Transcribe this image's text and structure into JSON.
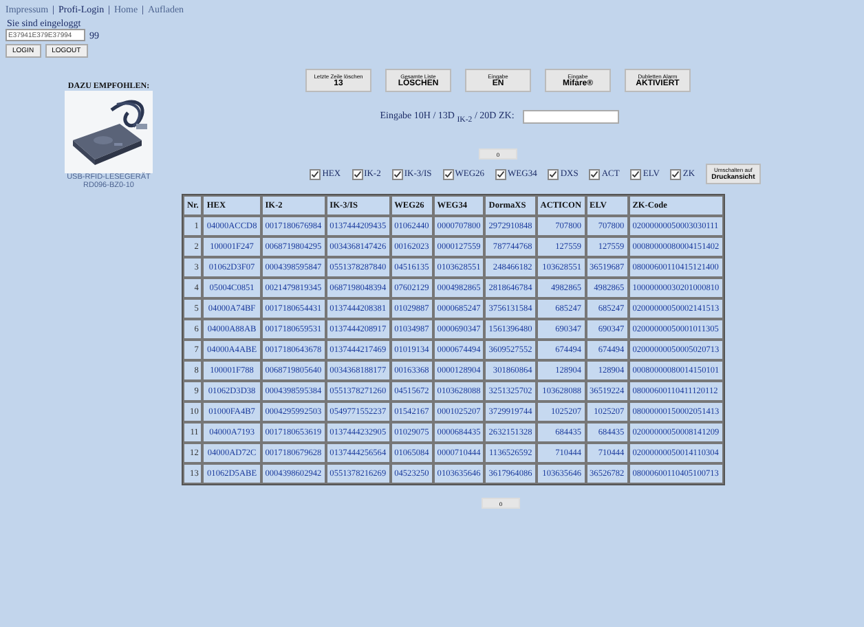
{
  "nav_links": [
    "Impressum",
    "Profi-Login",
    "Home",
    "Aufladen"
  ],
  "nav_separator": "|",
  "login": {
    "status": "Sie sind eingeloggt",
    "field_value": "E37941E379E37994",
    "count": "99",
    "buttons": [
      "LOGIN",
      "LOGOUT"
    ]
  },
  "recommendation": {
    "heading": "DAZU EMPFOHLEN:",
    "product_name": "USB-RFID-LESEGERÄT",
    "product_code": "RD096-BZ0-10"
  },
  "action_buttons": [
    {
      "label": "Letzte Zeile löschen",
      "value": "13"
    },
    {
      "label": "Gesamte Liste",
      "value": "LÖSCHEN"
    },
    {
      "label": "Eingabe",
      "value": "EN"
    },
    {
      "label": "Eingabe",
      "value": "Mifare®"
    },
    {
      "label": "Dubletten Alarm",
      "value": "AKTIVIERT"
    }
  ],
  "input_row": {
    "label": "Eingabe 10H / 13D $_{IK-2}$ / 20D ZK:"
  },
  "top_button": "0",
  "column_toggles": [
    {
      "label": "HEX",
      "checked": true
    },
    {
      "label": "IK-2",
      "checked": true
    },
    {
      "label": "IK-3/IS",
      "checked": true
    },
    {
      "label": "WEG26",
      "checked": true
    },
    {
      "label": "WEG34",
      "checked": true
    },
    {
      "label": "DXS",
      "checked": true
    },
    {
      "label": "ACT",
      "checked": true
    },
    {
      "label": "ELV",
      "checked": true
    },
    {
      "label": "ZK",
      "checked": true
    }
  ],
  "print_button": {
    "line1": "Umschalten auf",
    "line2": "Druckansicht"
  },
  "table": {
    "columns": [
      "Nr.",
      "HEX",
      "IK-2",
      "IK-3/IS",
      "WEG26",
      "WEG34",
      "DormaXS",
      "ACTICON",
      "ELV",
      "ZK-Code"
    ],
    "rows": [
      [
        "1",
        "04000ACCD8",
        "0017180676984",
        "0137444209435",
        "01062440",
        "0000707800",
        "2972910848",
        "707800",
        "707800",
        "02000000050003030111"
      ],
      [
        "2",
        "100001F247",
        "0068719804295",
        "0034368147426",
        "00162023",
        "0000127559",
        "787744768",
        "127559",
        "127559",
        "00080000080004151402"
      ],
      [
        "3",
        "01062D3F07",
        "0004398595847",
        "0551378287840",
        "04516135",
        "0103628551",
        "248466182",
        "103628551",
        "36519687",
        "08000600110415121400"
      ],
      [
        "4",
        "05004C0851",
        "0021479819345",
        "0687198048394",
        "07602129",
        "0004982865",
        "2818646784",
        "4982865",
        "4982865",
        "10000000030201000810"
      ],
      [
        "5",
        "04000A74BF",
        "0017180654431",
        "0137444208381",
        "01029887",
        "0000685247",
        "3756131584",
        "685247",
        "685247",
        "02000000050002141513"
      ],
      [
        "6",
        "04000A88AB",
        "0017180659531",
        "0137444208917",
        "01034987",
        "0000690347",
        "1561396480",
        "690347",
        "690347",
        "02000000050001011305"
      ],
      [
        "7",
        "04000A4ABE",
        "0017180643678",
        "0137444217469",
        "01019134",
        "0000674494",
        "3609527552",
        "674494",
        "674494",
        "02000000050005020713"
      ],
      [
        "8",
        "100001F788",
        "0068719805640",
        "0034368188177",
        "00163368",
        "0000128904",
        "301860864",
        "128904",
        "128904",
        "00080000080014150101"
      ],
      [
        "9",
        "01062D3D38",
        "0004398595384",
        "0551378271260",
        "04515672",
        "0103628088",
        "3251325702",
        "103628088",
        "36519224",
        "08000600110411120112"
      ],
      [
        "10",
        "01000FA4B7",
        "0004295992503",
        "0549771552237",
        "01542167",
        "0001025207",
        "3729919744",
        "1025207",
        "1025207",
        "08000000150002051413"
      ],
      [
        "11",
        "04000A7193",
        "0017180653619",
        "0137444232905",
        "01029075",
        "0000684435",
        "2632151328",
        "684435",
        "684435",
        "02000000050008141209"
      ],
      [
        "12",
        "04000AD72C",
        "0017180679628",
        "0137444256564",
        "01065084",
        "0000710444",
        "1136526592",
        "710444",
        "710444",
        "02000000050014110304"
      ],
      [
        "13",
        "01062D5ABE",
        "0004398602942",
        "0551378216269",
        "04523250",
        "0103635646",
        "3617964086",
        "103635646",
        "36526782",
        "08000600110405100713"
      ]
    ]
  },
  "bottom_button": "0"
}
